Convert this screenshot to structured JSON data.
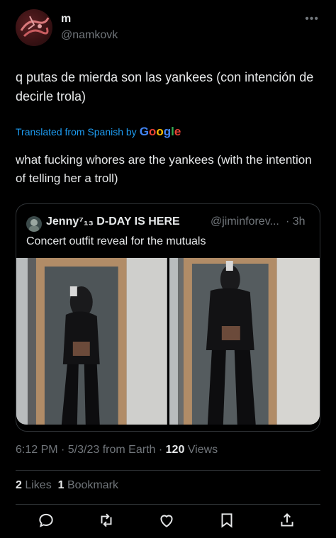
{
  "author": {
    "display_name": "m",
    "handle": "@namkovk",
    "more_icon": "more-horizontal-icon"
  },
  "tweet": {
    "text": "q putas de mierda son las yankees (con intención de decirle trola)",
    "translated_label": "Translated from Spanish by",
    "google_letters": [
      "G",
      "o",
      "o",
      "g",
      "l",
      "e"
    ],
    "translation": "what fucking whores are the yankees (with the intention of telling her a troll)"
  },
  "quoted": {
    "name": "Jenny⁷₁₃ D-DAY IS HERE",
    "handle": "@jiminforev...",
    "time": "· 3h",
    "text": "Concert outfit reveal for the mutuals"
  },
  "meta": {
    "time": "6:12 PM · 5/3/23 from Earth · ",
    "views_count": "120",
    "views_label": " Views"
  },
  "stats": {
    "likes_count": "2",
    "likes_label": " Likes  ",
    "bookmarks_count": "1",
    "bookmarks_label": " Bookmark"
  },
  "actions": [
    "reply-icon",
    "retweet-icon",
    "like-icon",
    "bookmark-icon",
    "share-icon"
  ],
  "colors": {
    "background": "#000000",
    "text": "#e7e9ea",
    "secondary": "#71767b",
    "link": "#1d9bf0",
    "border": "#2f3336"
  }
}
